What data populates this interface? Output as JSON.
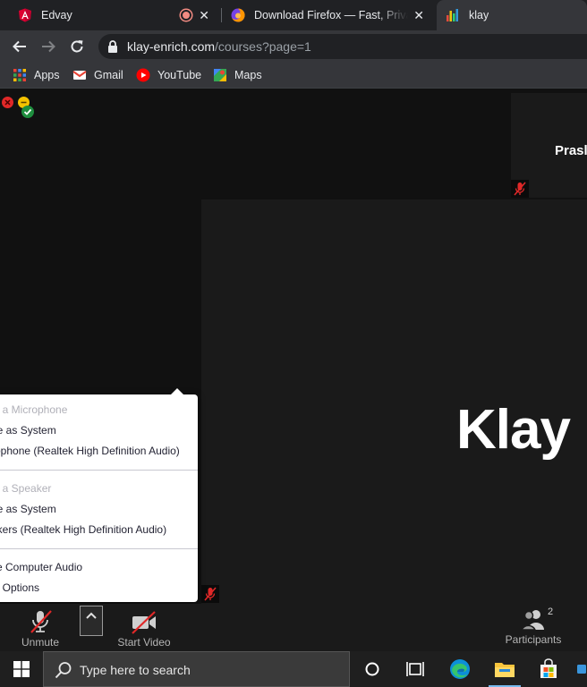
{
  "browser": {
    "tabs": [
      {
        "title": "Edvay",
        "favicon": "angular-icon"
      },
      {
        "title": "Download Firefox — Fast, Private",
        "favicon": "firefox-icon"
      },
      {
        "title": "klay",
        "favicon": "klay-icon"
      }
    ],
    "url": {
      "domain": "klay-enrich.com",
      "path": "/courses?page=1"
    },
    "bookmarks": [
      {
        "label": "Apps",
        "icon": "apps-grid-icon"
      },
      {
        "label": "Gmail",
        "icon": "gmail-icon"
      },
      {
        "label": "YouTube",
        "icon": "youtube-icon"
      },
      {
        "label": "Maps",
        "icon": "maps-icon"
      }
    ]
  },
  "meeting": {
    "participants": {
      "top_tile_name": "Prasl",
      "main_tile_name": "Klay"
    }
  },
  "audio_menu": {
    "mic_header": "ct a Microphone",
    "mic_items": [
      "ne as System",
      "rophone (Realtek High Definition Audio)"
    ],
    "speaker_header": "ct a Speaker",
    "speaker_items": [
      "ne as System",
      "akers (Realtek High Definition Audio)"
    ],
    "footer_items": [
      "ve Computer Audio",
      "io Options"
    ]
  },
  "controls": {
    "unmute_label": "Unmute",
    "start_video_label": "Start Video",
    "participants_label": "Participants",
    "participants_count": "2"
  },
  "taskbar": {
    "search_placeholder": "Type here to search"
  },
  "colors": {
    "chrome_dark": "#202124",
    "toolbar": "#35363a",
    "meeting_bg": "#111111",
    "tile_bg": "#1a1a1a",
    "muted_red": "#e02828",
    "taskbar": "#1f1f1f"
  }
}
